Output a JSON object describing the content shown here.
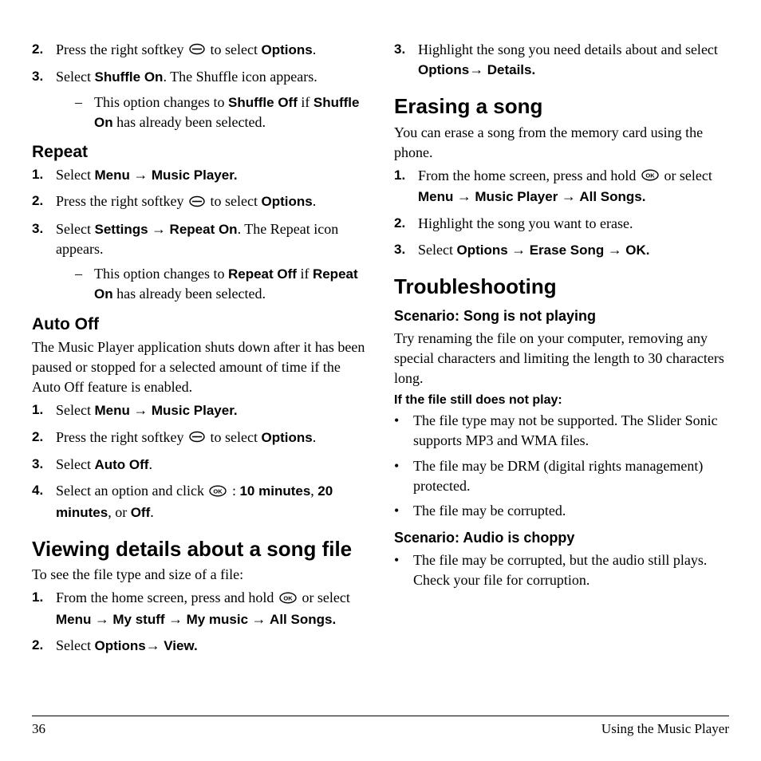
{
  "left": {
    "shuffle_steps": {
      "s2": {
        "n": "2.",
        "a": "Press the right softkey ",
        "b": " to select ",
        "opt": "Options",
        "tail": "."
      },
      "s3": {
        "n": "3.",
        "a": "Select ",
        "son": "Shuffle On",
        "tail": ". The Shuffle icon appears."
      },
      "sub": {
        "a": "This option changes to ",
        "soff": "Shuffle Off",
        "mid": " if ",
        "son": "Shuffle On",
        "tail": " has already been selected."
      }
    },
    "repeat": {
      "h": "Repeat",
      "s1": {
        "n": "1.",
        "a": "Select ",
        "menu": "Menu",
        "arrow": " → ",
        "mp": "Music Player."
      },
      "s2": {
        "n": "2.",
        "a": "Press the right softkey ",
        "b": " to select ",
        "opt": "Options",
        "tail": "."
      },
      "s3": {
        "n": "3.",
        "a": "Select ",
        "set": "Settings",
        "arrow": " → ",
        "ron": "Repeat On",
        "tail": ". The Repeat icon appears."
      },
      "sub": {
        "a": "This option changes to ",
        "roff": "Repeat Off",
        "mid": " if ",
        "ron": "Repeat On",
        "tail": " has already been selected."
      }
    },
    "autooff": {
      "h": "Auto Off",
      "p": "The Music Player application shuts down after it has been paused or stopped for a selected amount of time if the Auto Off feature is enabled.",
      "s1": {
        "n": "1.",
        "a": "Select ",
        "menu": "Menu",
        "arrow": " → ",
        "mp": "Music Player."
      },
      "s2": {
        "n": "2.",
        "a": "Press the right softkey ",
        "b": " to select ",
        "opt": "Options",
        "tail": "."
      },
      "s3": {
        "n": "3.",
        "a": "Select ",
        "ao": "Auto Off",
        "tail": "."
      },
      "s4": {
        "n": "4.",
        "a": "Select an option and click ",
        "b": " : ",
        "t10": "10 minutes",
        "comma": ", ",
        "t20": "20 minutes",
        "or": ", or ",
        "off": "Off",
        "tail": "."
      }
    },
    "viewing": {
      "h": "Viewing details about a song file",
      "p": "To see the file type and size of a file:",
      "s1": {
        "n": "1.",
        "a": "From the home screen, press and hold ",
        "or": "or select ",
        "menu": "Menu",
        "arrow": " → ",
        "ms": "My stuff",
        "arrow2": " → ",
        "mm": "My music",
        "arrow3": " → ",
        "as": "All Songs."
      },
      "s2": {
        "n": "2.",
        "a": "Select ",
        "opt": "Options",
        "arrow": "→ ",
        "view": "View."
      }
    }
  },
  "right": {
    "s3": {
      "n": "3.",
      "a": "Highlight the song you need details about and select ",
      "opt": "Options",
      "arrow": "→ ",
      "det": "Details."
    },
    "erase": {
      "h": "Erasing a song",
      "p": "You can erase a song from the memory card using the phone.",
      "s1": {
        "n": "1.",
        "a": "From the home screen, press and hold ",
        "or": "or select ",
        "menu": "Menu",
        "arrow": " → ",
        "mp": "Music Player",
        "arrow2": " → ",
        "as": "All Songs."
      },
      "s2": {
        "n": "2.",
        "a": "Highlight the song you want to erase."
      },
      "s3": {
        "n": "3.",
        "a": "Select ",
        "opt": "Options",
        "arrow": " → ",
        "es": "Erase Song",
        "arrow2": " → ",
        "ok": "OK."
      }
    },
    "trouble": {
      "h": "Troubleshooting",
      "sc1h": "Scenario: Song is not playing",
      "sc1p": "Try renaming the file on your computer, removing any special characters and limiting the length to 30 characters long.",
      "note": "If the file still does not play:",
      "b1": "The file type may not be supported. The Slider Sonic supports MP3 and WMA files.",
      "b2": "The file may be DRM (digital rights management) protected.",
      "b3": "The file may be corrupted.",
      "sc2h": "Scenario: Audio is choppy",
      "sc2b": "The file may be corrupted, but the audio still plays. Check your file for corruption."
    }
  },
  "footer": {
    "page": "36",
    "title": "Using the Music Player"
  }
}
